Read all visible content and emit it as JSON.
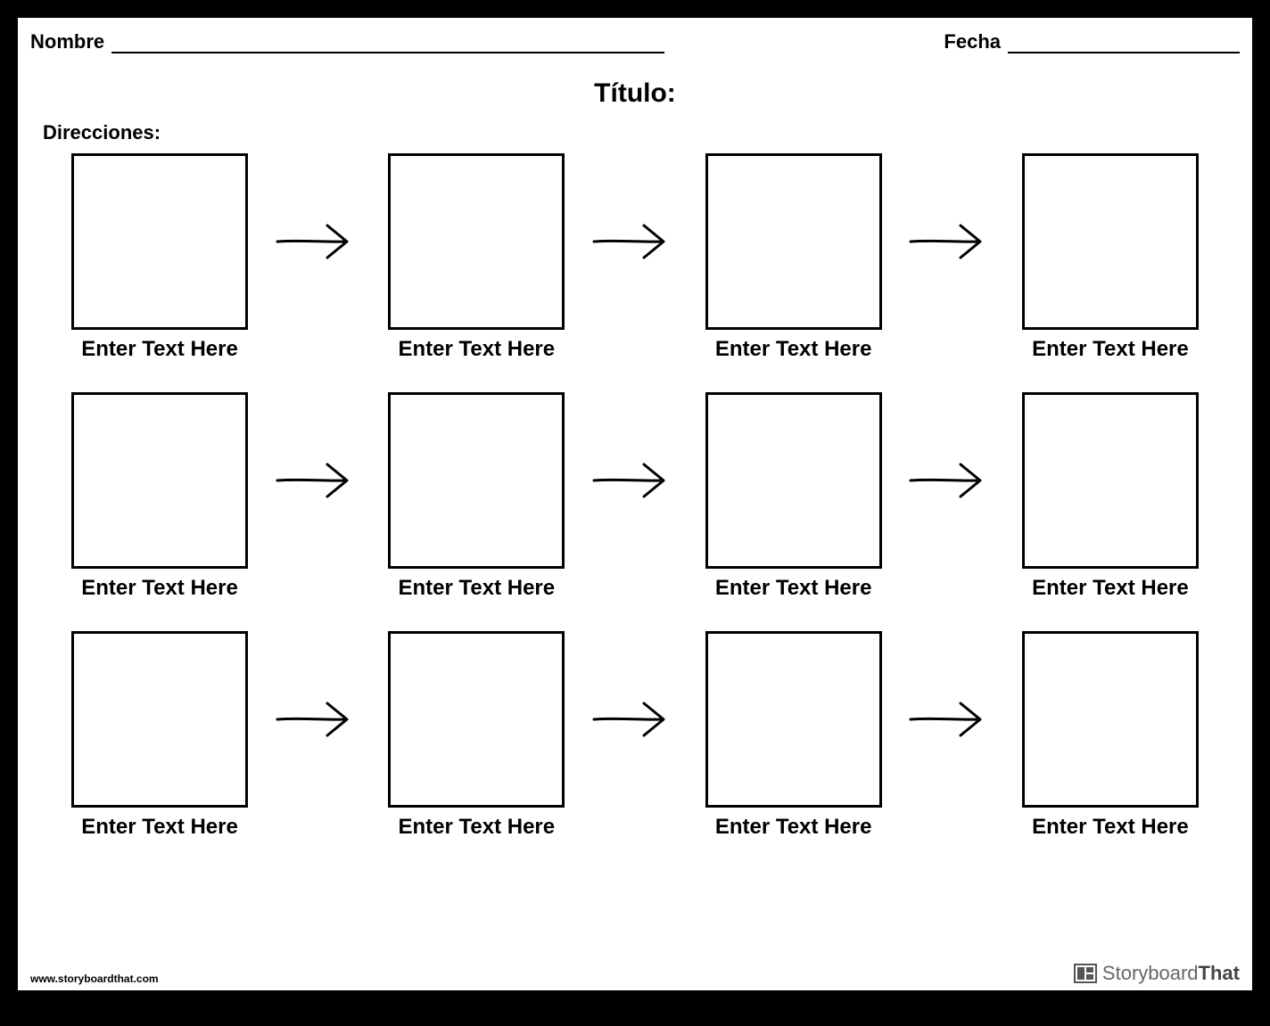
{
  "header": {
    "name_label": "Nombre",
    "date_label": "Fecha"
  },
  "title": "Título:",
  "directions_label": "Direcciones:",
  "rows": [
    {
      "cells": [
        "Enter Text Here",
        "Enter Text Here",
        "Enter Text Here",
        "Enter Text Here"
      ]
    },
    {
      "cells": [
        "Enter Text Here",
        "Enter Text Here",
        "Enter Text Here",
        "Enter Text Here"
      ]
    },
    {
      "cells": [
        "Enter Text Here",
        "Enter Text Here",
        "Enter Text Here",
        "Enter Text Here"
      ]
    }
  ],
  "footer": {
    "url": "www.storyboardthat.com",
    "brand_word1": "Storyboard",
    "brand_word2": "That"
  }
}
